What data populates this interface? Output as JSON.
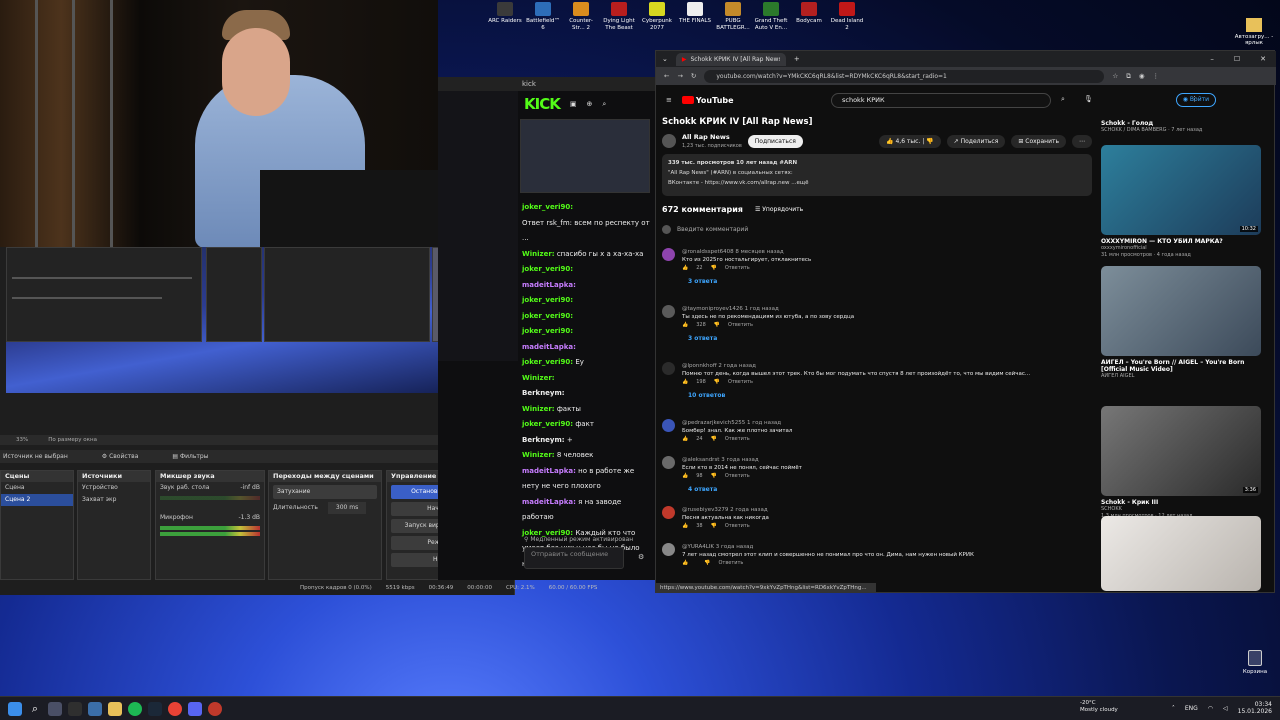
{
  "desktop": {
    "icons": [
      {
        "label": "ARC Raiders",
        "color": "#3a3a3a"
      },
      {
        "label": "Battlefield™ 6",
        "color": "#2d6db8"
      },
      {
        "label": "Counter-Str... 2",
        "color": "#d98c1e"
      },
      {
        "label": "Dying Light The Beast",
        "color": "#b81e1e"
      },
      {
        "label": "Cyberpunk 2077",
        "color": "#d8d820"
      },
      {
        "label": "THE FINALS",
        "color": "#eeeeee"
      },
      {
        "label": "PUBG BATTLEGR...",
        "color": "#c48a2a"
      },
      {
        "label": "Grand Theft Auto V En...",
        "color": "#2b7a2b"
      },
      {
        "label": "Bodycam",
        "color": "#b32020"
      },
      {
        "label": "Dead Island 2",
        "color": "#c01818"
      }
    ],
    "right_label": "Автозагру... - ярлык",
    "recycle_bin": "Корзина"
  },
  "obs": {
    "scale_label": "По размеру окна",
    "zoom": "33%",
    "source_status": "Источник не выбран",
    "properties": "Свойства",
    "filters": "Фильтры",
    "scenes_title": "Сцены",
    "scenes": [
      "Сцена",
      "Сцена 2"
    ],
    "sources_title": "Источники",
    "sources": [
      "Устройство",
      "Захват экр"
    ],
    "mixer_title": "Микшер звука",
    "mixer": [
      {
        "name": "Звук раб. стола",
        "db": "-inf dB"
      },
      {
        "name": "Микрофон",
        "db": "-1.3 dB"
      }
    ],
    "transitions_title": "Переходы между сценами",
    "transition_value": "Затухание",
    "duration_label": "Длительность",
    "duration_value": "300 ms",
    "controls_title": "Управление",
    "controls": [
      "Остановить трансляцию",
      "Начать запись",
      "Запуск виртуальной камеры",
      "Режим студии",
      "Настройки"
    ],
    "status": {
      "dropped": "Пропуск кадров 0 (0.0%)",
      "bitrate": "5519 kbps",
      "time": "00:36:49",
      "rec_time": "00:00:00",
      "cpu": "CPU: 2.1%",
      "fps": "60.00 / 60.00 FPS"
    }
  },
  "kick": {
    "window_title": "kick",
    "logo": "KICK",
    "chat": [
      {
        "user": "joker_veri90:",
        "text": "",
        "c": "u"
      },
      {
        "user": "",
        "text": "Ответ rsk_fm: всем по респекту от ...",
        "c": "u"
      },
      {
        "user": "Winizer:",
        "text": "спасибо гы х а ха-ха-ха",
        "c": "u"
      },
      {
        "user": "joker_veri90:",
        "text": "",
        "c": "u"
      },
      {
        "user": "madeitLapka:",
        "text": "",
        "c": "u2"
      },
      {
        "user": "joker_veri90:",
        "text": "",
        "c": "u"
      },
      {
        "user": "joker_veri90:",
        "text": "",
        "c": "u"
      },
      {
        "user": "joker_veri90:",
        "text": "",
        "c": "u"
      },
      {
        "user": "madeitLapka:",
        "text": "",
        "c": "u2"
      },
      {
        "user": "joker_veri90:",
        "text": "Ey",
        "c": "u"
      },
      {
        "user": "Winizer:",
        "text": "",
        "c": "u"
      },
      {
        "user": "Berkneym:",
        "text": "",
        "c": "t"
      },
      {
        "user": "Winizer:",
        "text": "факты",
        "c": "u"
      },
      {
        "user": "joker_veri90:",
        "text": "факт",
        "c": "u"
      },
      {
        "user": "Berkneym:",
        "text": "+",
        "c": "t"
      },
      {
        "user": "Winizer:",
        "text": "8 человек",
        "c": "u"
      },
      {
        "user": "madeitLapka:",
        "text": "но в работе же нету не чего плохого",
        "c": "u2"
      },
      {
        "user": "madeitLapka:",
        "text": "я на заводе работаю",
        "c": "u2"
      },
      {
        "user": "joker_veri90:",
        "text": "Каждый кто что умеет без них у нас бы не было нечего",
        "c": "u"
      }
    ],
    "slow_mode": "Медленный режим активирован",
    "input_placeholder": "Отправить сообщение"
  },
  "browser": {
    "tab_title": "Schokk КРИК IV [All Rap News]",
    "url": "youtube.com/watch?v=YMkCKC6qRL8&list=RDYMkCKC6qRL8&start_radio=1",
    "search_value": "schokk КРИК",
    "sign_in": "Войти",
    "logo": "YouTube",
    "video_title": "Schokk КРИК IV [All Rap News]",
    "channel": "All Rap News",
    "subs": "1,23 тыс. подписчиков",
    "subscribe": "Подписаться",
    "likes": "4,6 тыс.",
    "share": "Поделиться",
    "save": "Сохранить",
    "desc_line1": "339 тыс. просмотров  10 лет назад  #ARN",
    "desc_line2": "\"All Rap News\" (#ARN) в социальных сетях:",
    "desc_line3": "ВКонтакте - https://www.vk.com/allrap.new  ...ещё",
    "comments_count": "672 комментария",
    "sort": "Упорядочить",
    "add_comment": "Введите комментарий",
    "comments": [
      {
        "name": "@ronaldsspet6408  8 месяцев назад",
        "text": "Кто из 2025го ностальгирует, отклакнитесь",
        "likes": "22",
        "replies": "3 ответа",
        "color": "#8e44ad"
      },
      {
        "name": "@taymoniproyev1426  1 год назад",
        "text": "Ты здесь не по рекомендациям из ютуба, а по зову сердца",
        "likes": "328",
        "replies": "3 ответа",
        "color": "#5a5a5a"
      },
      {
        "name": "@lponnkhoff  2 года назад",
        "text": "Помню тот день, когда вышел этот трек. Кто бы мог подумать что спустя 8 лет произойдёт то, что мы видим сейчас...",
        "likes": "198",
        "replies": "10 ответов",
        "color": "#2b2b2b"
      },
      {
        "name": "@pedrazarjkevich5255  1 год назад",
        "text": "Бомбер! знал. Как же плотно зачитал",
        "likes": "24",
        "replies": "",
        "color": "#3a55b8"
      },
      {
        "name": "@aleksandrst  3 года назад",
        "text": "Если кто в 2014 не понял, сейчас поймёт",
        "likes": "98",
        "replies": "4 ответа",
        "color": "#6a6a6a"
      },
      {
        "name": "@rusebiyev3279  2 года назад",
        "text": "Песня актуальна как никогда",
        "likes": "38",
        "replies": "",
        "color": "#c0392b"
      },
      {
        "name": "@YURA4LIK  3 года назад",
        "text": "7 лет назад смотрел этот клип и совершенно не понимал про что он. Дима, нам нужен новый КРИК",
        "likes": "",
        "replies": "",
        "color": "#888888"
      }
    ],
    "recs": [
      {
        "title": "OXXXYMIRON — КТО УБИЛ МАРКА?",
        "meta": "oxxxymironofficial",
        "meta2": "31 млн просмотров · 4 года назад",
        "dur": "10:32",
        "c1": "#2d7f9c",
        "c2": "#1d3c5a"
      },
      {
        "title": "АИГЕЛ – You're Born // AIGEL – You're Born [Official Music Video]",
        "meta": "АИГЕЛ AIGEL",
        "meta2": "",
        "dur": "",
        "c1": "#7d8e9a",
        "c2": "#3c4a5a"
      },
      {
        "title": "Schokk - Крик III",
        "meta": "SCHOKK",
        "meta2": "1,3 млн просмотров · 12 лет назад",
        "dur": "3:36",
        "c1": "#777777",
        "c2": "#2a2a2a"
      },
      {
        "title": "",
        "meta": "",
        "meta2": "",
        "dur": "",
        "c1": "#ece9e6",
        "c2": "#b9b4ae"
      }
    ],
    "rec_top": {
      "title": "Schokk - Голод",
      "meta": "SCHOKK / DIMA BAMBERG  ·  7 лет назад"
    },
    "status_url": "https://www.youtube.com/watch?v=9xkYvZpTHng&list=RD6xkYvZpTHng..."
  },
  "taskbar": {
    "weather_temp": "-20°C",
    "weather_desc": "Mostly cloudy",
    "lang": "ENG",
    "time": "03:34",
    "date": "15.01.2026"
  }
}
